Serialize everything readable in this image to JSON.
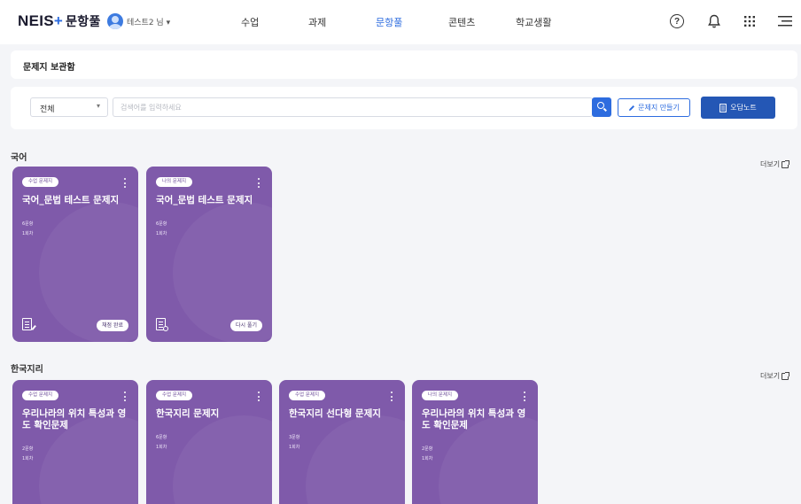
{
  "nav": {
    "brand_main": "NEIS",
    "brand_plus": "+",
    "brand_sub": "문항풀",
    "username": "테스트2 님 ▾",
    "menu": [
      "수업",
      "과제",
      "문항풀",
      "콘텐츠",
      "학교생활"
    ],
    "active_menu": "문항풀",
    "icons": [
      "help-icon",
      "bell-icon",
      "grid-icon",
      "menu-icon"
    ]
  },
  "page": {
    "title": "문제지 보관함"
  },
  "search": {
    "filter_value": "전체",
    "placeholder": "검색어를 입력하세요",
    "make_label": "문제지 만들기",
    "notes_label": "오답노트"
  },
  "sections": [
    {
      "title": "국어",
      "more_label": "더보기",
      "cards": [
        {
          "badge": "수업 문제지",
          "title": "국어_문법 테스트 문제지",
          "count": "6문항",
          "round": "1회차",
          "icon": "doc-edit-icon",
          "action": "채점 완료"
        },
        {
          "badge": "나의 문제지",
          "title": "국어_문법 테스트 문제지",
          "count": "6문항",
          "round": "1회차",
          "icon": "doc-search-icon",
          "action": "다시 풀기"
        }
      ]
    },
    {
      "title": "한국지리",
      "more_label": "더보기",
      "cards": [
        {
          "badge": "수업 문제지",
          "title": "우리나라의 위치 특성과 영도 확인문제",
          "count": "2문항",
          "round": "1회차"
        },
        {
          "badge": "수업 문제지",
          "title": "한국지리 문제지",
          "count": "6문항",
          "round": "1회차"
        },
        {
          "badge": "수업 문제지",
          "title": "한국지리 선다형 문제지",
          "count": "3문항",
          "round": "1회차"
        },
        {
          "badge": "나의 문제지",
          "title": "우리나라의 위치 특성과 영도 확인문제",
          "count": "2문항",
          "round": "1회차"
        }
      ]
    }
  ],
  "colors": {
    "accent": "#2d6cdf",
    "card": "#7f5aaa",
    "notes_button": "#2457b5"
  }
}
